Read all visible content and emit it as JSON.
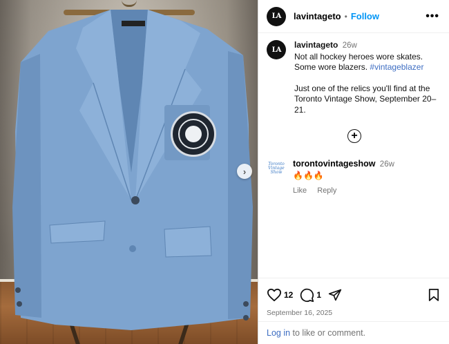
{
  "header": {
    "avatar_text": "LA",
    "username": "lavintageto",
    "separator": "•",
    "follow_label": "Follow",
    "more_label": "•••"
  },
  "caption": {
    "username": "lavintageto",
    "time": "26w",
    "text_part1": "Not all hockey heroes wore skates. Some wore blazers. ",
    "hashtag": "#vintageblazer",
    "text_part2": "Just one of the relics you'll find at the Toronto Vintage Show, September 20–21."
  },
  "view_more_label": "+",
  "comment": {
    "avatar_text": "Toronto Vintage Show",
    "username": "torontovintageshow",
    "time": "26w",
    "text": "🔥🔥🔥",
    "like_label": "Like",
    "reply_label": "Reply"
  },
  "footer": {
    "like_count": "12",
    "comment_count": "1",
    "date": "September 16, 2025",
    "login_link": "Log in",
    "login_text": " to like or comment."
  },
  "colors": {
    "accent": "#0095f6",
    "link": "#3d6dc2",
    "blazer": "#7ea4cf",
    "muted": "#737373"
  },
  "icons": [
    "heart-icon",
    "comment-icon",
    "share-icon",
    "bookmark-icon",
    "chevron-right-icon",
    "plus-circle-icon",
    "more-icon"
  ]
}
